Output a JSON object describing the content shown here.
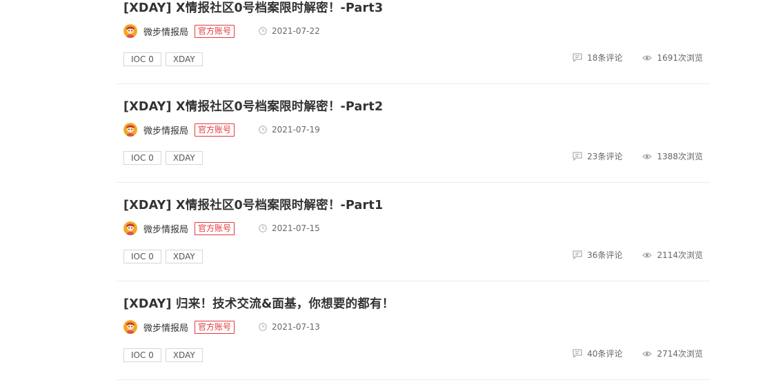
{
  "colors": {
    "badge": "#e4393c",
    "title": "#333333",
    "muted": "#666666",
    "divider": "#ebebeb"
  },
  "articles": [
    {
      "title": "[XDAY] X情报社区0号档案限时解密！-Part3",
      "author": "微步情报局",
      "badge": "官方账号",
      "date": "2021-07-22",
      "tags": [
        "IOC 0",
        "XDAY"
      ],
      "comments": "18条评论",
      "views": "1691次浏览"
    },
    {
      "title": "[XDAY] X情报社区0号档案限时解密！-Part2",
      "author": "微步情报局",
      "badge": "官方账号",
      "date": "2021-07-19",
      "tags": [
        "IOC 0",
        "XDAY"
      ],
      "comments": "23条评论",
      "views": "1388次浏览"
    },
    {
      "title": "[XDAY] X情报社区0号档案限时解密！-Part1",
      "author": "微步情报局",
      "badge": "官方账号",
      "date": "2021-07-15",
      "tags": [
        "IOC 0",
        "XDAY"
      ],
      "comments": "36条评论",
      "views": "2114次浏览"
    },
    {
      "title": "[XDAY] 归来！技术交流&面基，你想要的都有！",
      "author": "微步情报局",
      "badge": "官方账号",
      "date": "2021-07-13",
      "tags": [
        "IOC 0",
        "XDAY"
      ],
      "comments": "40条评论",
      "views": "2714次浏览"
    }
  ]
}
